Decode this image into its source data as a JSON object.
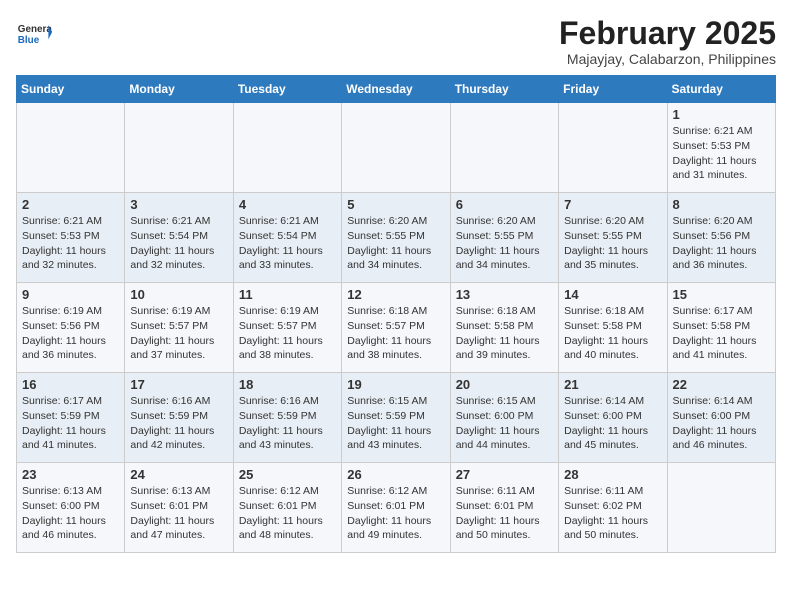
{
  "header": {
    "logo_general": "General",
    "logo_blue": "Blue",
    "month_title": "February 2025",
    "subtitle": "Majayjay, Calabarzon, Philippines"
  },
  "days_of_week": [
    "Sunday",
    "Monday",
    "Tuesday",
    "Wednesday",
    "Thursday",
    "Friday",
    "Saturday"
  ],
  "weeks": [
    [
      {
        "day": "",
        "info": ""
      },
      {
        "day": "",
        "info": ""
      },
      {
        "day": "",
        "info": ""
      },
      {
        "day": "",
        "info": ""
      },
      {
        "day": "",
        "info": ""
      },
      {
        "day": "",
        "info": ""
      },
      {
        "day": "1",
        "info": "Sunrise: 6:21 AM\nSunset: 5:53 PM\nDaylight: 11 hours and 31 minutes."
      }
    ],
    [
      {
        "day": "2",
        "info": "Sunrise: 6:21 AM\nSunset: 5:53 PM\nDaylight: 11 hours and 32 minutes."
      },
      {
        "day": "3",
        "info": "Sunrise: 6:21 AM\nSunset: 5:54 PM\nDaylight: 11 hours and 32 minutes."
      },
      {
        "day": "4",
        "info": "Sunrise: 6:21 AM\nSunset: 5:54 PM\nDaylight: 11 hours and 33 minutes."
      },
      {
        "day": "5",
        "info": "Sunrise: 6:20 AM\nSunset: 5:55 PM\nDaylight: 11 hours and 34 minutes."
      },
      {
        "day": "6",
        "info": "Sunrise: 6:20 AM\nSunset: 5:55 PM\nDaylight: 11 hours and 34 minutes."
      },
      {
        "day": "7",
        "info": "Sunrise: 6:20 AM\nSunset: 5:55 PM\nDaylight: 11 hours and 35 minutes."
      },
      {
        "day": "8",
        "info": "Sunrise: 6:20 AM\nSunset: 5:56 PM\nDaylight: 11 hours and 36 minutes."
      }
    ],
    [
      {
        "day": "9",
        "info": "Sunrise: 6:19 AM\nSunset: 5:56 PM\nDaylight: 11 hours and 36 minutes."
      },
      {
        "day": "10",
        "info": "Sunrise: 6:19 AM\nSunset: 5:57 PM\nDaylight: 11 hours and 37 minutes."
      },
      {
        "day": "11",
        "info": "Sunrise: 6:19 AM\nSunset: 5:57 PM\nDaylight: 11 hours and 38 minutes."
      },
      {
        "day": "12",
        "info": "Sunrise: 6:18 AM\nSunset: 5:57 PM\nDaylight: 11 hours and 38 minutes."
      },
      {
        "day": "13",
        "info": "Sunrise: 6:18 AM\nSunset: 5:58 PM\nDaylight: 11 hours and 39 minutes."
      },
      {
        "day": "14",
        "info": "Sunrise: 6:18 AM\nSunset: 5:58 PM\nDaylight: 11 hours and 40 minutes."
      },
      {
        "day": "15",
        "info": "Sunrise: 6:17 AM\nSunset: 5:58 PM\nDaylight: 11 hours and 41 minutes."
      }
    ],
    [
      {
        "day": "16",
        "info": "Sunrise: 6:17 AM\nSunset: 5:59 PM\nDaylight: 11 hours and 41 minutes."
      },
      {
        "day": "17",
        "info": "Sunrise: 6:16 AM\nSunset: 5:59 PM\nDaylight: 11 hours and 42 minutes."
      },
      {
        "day": "18",
        "info": "Sunrise: 6:16 AM\nSunset: 5:59 PM\nDaylight: 11 hours and 43 minutes."
      },
      {
        "day": "19",
        "info": "Sunrise: 6:15 AM\nSunset: 5:59 PM\nDaylight: 11 hours and 43 minutes."
      },
      {
        "day": "20",
        "info": "Sunrise: 6:15 AM\nSunset: 6:00 PM\nDaylight: 11 hours and 44 minutes."
      },
      {
        "day": "21",
        "info": "Sunrise: 6:14 AM\nSunset: 6:00 PM\nDaylight: 11 hours and 45 minutes."
      },
      {
        "day": "22",
        "info": "Sunrise: 6:14 AM\nSunset: 6:00 PM\nDaylight: 11 hours and 46 minutes."
      }
    ],
    [
      {
        "day": "23",
        "info": "Sunrise: 6:13 AM\nSunset: 6:00 PM\nDaylight: 11 hours and 46 minutes."
      },
      {
        "day": "24",
        "info": "Sunrise: 6:13 AM\nSunset: 6:01 PM\nDaylight: 11 hours and 47 minutes."
      },
      {
        "day": "25",
        "info": "Sunrise: 6:12 AM\nSunset: 6:01 PM\nDaylight: 11 hours and 48 minutes."
      },
      {
        "day": "26",
        "info": "Sunrise: 6:12 AM\nSunset: 6:01 PM\nDaylight: 11 hours and 49 minutes."
      },
      {
        "day": "27",
        "info": "Sunrise: 6:11 AM\nSunset: 6:01 PM\nDaylight: 11 hours and 50 minutes."
      },
      {
        "day": "28",
        "info": "Sunrise: 6:11 AM\nSunset: 6:02 PM\nDaylight: 11 hours and 50 minutes."
      },
      {
        "day": "",
        "info": ""
      }
    ]
  ]
}
